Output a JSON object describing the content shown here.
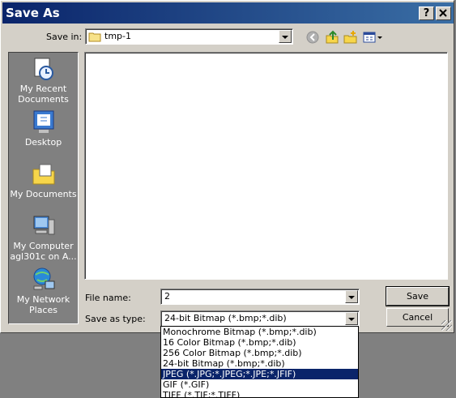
{
  "window": {
    "title": "Save As",
    "help_button": "?",
    "close_button": "✕"
  },
  "save_in": {
    "label": "Save in:",
    "value": "tmp-1"
  },
  "toolbar": {
    "icons": [
      "back-icon",
      "up-folder-icon",
      "new-folder-icon",
      "views-menu-icon"
    ]
  },
  "places": [
    {
      "label_lines": [
        "My Recent",
        "Documents"
      ],
      "icon": "recent-documents-icon"
    },
    {
      "label_lines": [
        "Desktop"
      ],
      "icon": "desktop-icon"
    },
    {
      "label_lines": [
        "My Documents"
      ],
      "icon": "my-documents-icon"
    },
    {
      "label_lines": [
        "My Computer",
        "agl301c on A..."
      ],
      "icon": "my-computer-icon"
    },
    {
      "label_lines": [
        "My Network",
        "Places"
      ],
      "icon": "network-places-icon"
    }
  ],
  "file_name": {
    "label": "File name:",
    "value": "2"
  },
  "save_as_type": {
    "label": "Save as type:",
    "value": "24-bit Bitmap (*.bmp;*.dib)",
    "options": [
      "Monochrome Bitmap (*.bmp;*.dib)",
      "16 Color Bitmap (*.bmp;*.dib)",
      "256 Color Bitmap (*.bmp;*.dib)",
      "24-bit Bitmap (*.bmp;*.dib)",
      "JPEG (*.JPG;*.JPEG;*.JPE;*.JFIF)",
      "GIF (*.GIF)",
      "TIFF (*.TIF;*.TIFF)"
    ],
    "highlighted_index": 4
  },
  "buttons": {
    "save": "Save",
    "cancel": "Cancel"
  },
  "colors": {
    "title_bar": "#0a246a",
    "dialog_bg": "#d4d0c8",
    "places_bg": "#808080",
    "selection": "#0a246a"
  }
}
